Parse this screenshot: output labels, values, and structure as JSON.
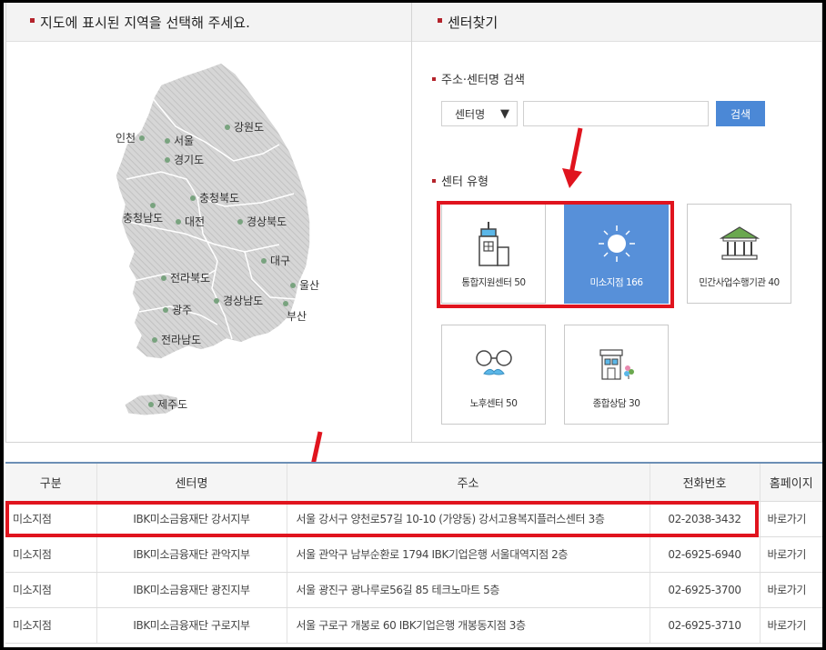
{
  "map_panel": {
    "title": "지도에 표시된 지역을 선택해 주세요.",
    "regions": [
      {
        "id": "incheon",
        "label": "인천"
      },
      {
        "id": "seoul",
        "label": "서울"
      },
      {
        "id": "gangwon",
        "label": "강원도"
      },
      {
        "id": "gyeonggi",
        "label": "경기도"
      },
      {
        "id": "chungbuk",
        "label": "충청북도"
      },
      {
        "id": "chungnam",
        "label": "충청남도"
      },
      {
        "id": "daejeon",
        "label": "대전"
      },
      {
        "id": "gyeongbuk",
        "label": "경상북도"
      },
      {
        "id": "daegu",
        "label": "대구"
      },
      {
        "id": "jeonbuk",
        "label": "전라북도"
      },
      {
        "id": "ulsan",
        "label": "울산"
      },
      {
        "id": "gwangju",
        "label": "광주"
      },
      {
        "id": "gyeongnam",
        "label": "경상남도"
      },
      {
        "id": "busan",
        "label": "부산"
      },
      {
        "id": "jeonnam",
        "label": "전라남도"
      },
      {
        "id": "jeju",
        "label": "제주도"
      }
    ]
  },
  "center_panel": {
    "title": "센터찾기",
    "search_title": "주소·센터명 검색",
    "select_value": "센터명",
    "select_arrow": "▼",
    "search_input_value": "",
    "search_button": "검색",
    "type_title": "센터 유형",
    "cards": [
      {
        "id": "integrated",
        "label": "통합지원센터  50",
        "icon": "building-icon",
        "active": false
      },
      {
        "id": "microfinance",
        "label": "미소지점  166",
        "icon": "sun-icon",
        "active": true
      },
      {
        "id": "private",
        "label": "민간사업수행기관  40",
        "icon": "bank-icon",
        "active": false
      },
      {
        "id": "nohu",
        "label": "노후센터  50",
        "icon": "glasses-mustache-icon",
        "active": false
      },
      {
        "id": "consult",
        "label": "종합상담  30",
        "icon": "shop-icon",
        "active": false
      }
    ]
  },
  "table": {
    "headers": [
      "구분",
      "센터명",
      "주소",
      "전화번호",
      "홈페이지"
    ],
    "rows": [
      [
        "미소지점",
        "IBK미소금융재단 강서지부",
        "서울 강서구 양천로57길 10-10 (가양동) 강서고용복지플러스센터 3층",
        "02-2038-3432",
        "바로가기"
      ],
      [
        "미소지점",
        "IBK미소금융재단 관악지부",
        "서울 관악구 남부순환로 1794 IBK기업은행 서울대역지점 2층",
        "02-6925-6940",
        "바로가기"
      ],
      [
        "미소지점",
        "IBK미소금융재단 광진지부",
        "서울 광진구 광나루로56길 85 테크노마트 5층",
        "02-6925-3700",
        "바로가기"
      ],
      [
        "미소지점",
        "IBK미소금융재단 구로지부",
        "서울 구로구 개봉로 60 IBK기업은행 개봉동지점 3층",
        "02-6925-3710",
        "바로가기"
      ]
    ]
  },
  "colors": {
    "accent_blue": "#5790d9",
    "highlight_red": "#e0141e",
    "bullet_red": "#b4232b"
  }
}
